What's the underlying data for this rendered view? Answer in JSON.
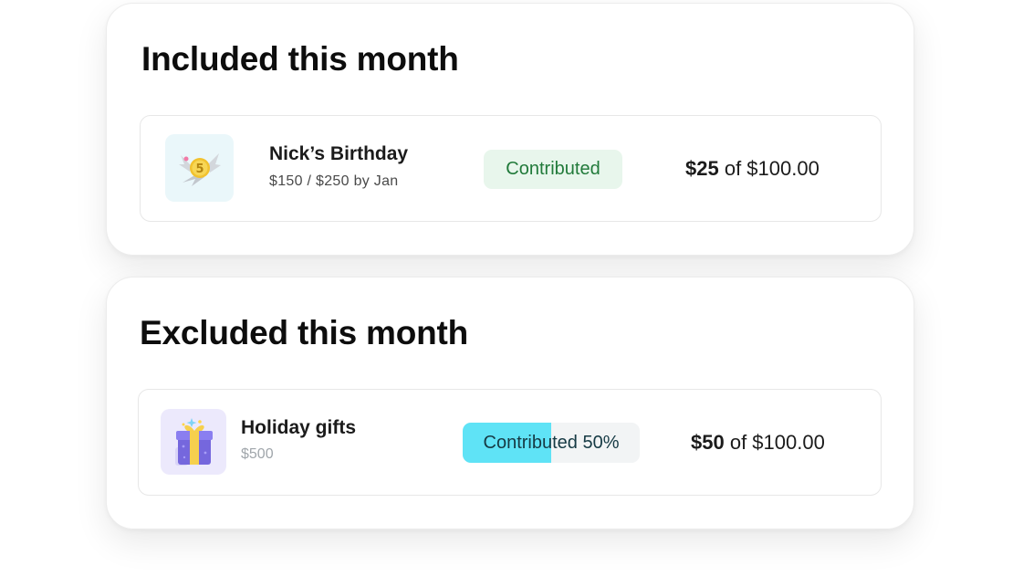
{
  "included": {
    "title": "Included this month",
    "item": {
      "icon": "coin-with-wings-icon",
      "name": "Nick’s Birthday",
      "subtitle": "$150 / $250 by Jan",
      "status": "Contributed",
      "amount_strong": "$25",
      "amount_rest": " of $100.00"
    }
  },
  "excluded": {
    "title": "Excluded this month",
    "item": {
      "icon": "gift-box-icon",
      "name": "Holiday gifts",
      "subtitle": "$500",
      "progress_label": "Contributed 50%",
      "progress_fraction": 0.5,
      "amount_strong": "$50",
      "amount_rest": " of $100.00"
    }
  },
  "colors": {
    "status_bg": "#e8f6ec",
    "status_text": "#217a3a",
    "progress_fill": "#5fe3f6",
    "progress_track": "#f2f4f5"
  }
}
